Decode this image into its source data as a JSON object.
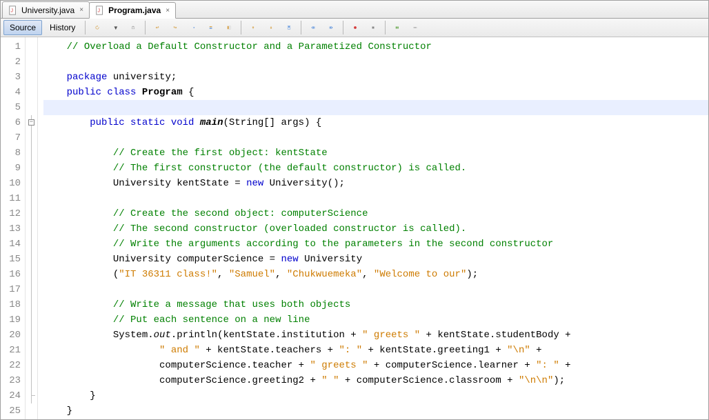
{
  "tabs": [
    {
      "title": "University.java",
      "active": false
    },
    {
      "title": "Program.java",
      "active": true
    }
  ],
  "toolbar": {
    "source": "Source",
    "history": "History"
  },
  "code": {
    "lines": [
      {
        "n": 1,
        "segs": [
          {
            "t": "    ",
            "c": ""
          },
          {
            "t": "// Overload a Default Constructor and a Parametized Constructor",
            "c": "cmt"
          }
        ]
      },
      {
        "n": 2,
        "segs": [
          {
            "t": " ",
            "c": ""
          }
        ]
      },
      {
        "n": 3,
        "segs": [
          {
            "t": "    ",
            "c": ""
          },
          {
            "t": "package ",
            "c": "kw"
          },
          {
            "t": "university;",
            "c": "id"
          }
        ]
      },
      {
        "n": 4,
        "segs": [
          {
            "t": "    ",
            "c": ""
          },
          {
            "t": "public class ",
            "c": "kw"
          },
          {
            "t": "Program",
            "c": "id bold"
          },
          {
            "t": " {",
            "c": "id"
          }
        ]
      },
      {
        "n": 5,
        "segs": [
          {
            "t": " ",
            "c": ""
          }
        ],
        "current": true
      },
      {
        "n": 6,
        "segs": [
          {
            "t": "        ",
            "c": ""
          },
          {
            "t": "public static void ",
            "c": "kw"
          },
          {
            "t": "main",
            "c": "id bold italic"
          },
          {
            "t": "(String[] args) {",
            "c": "id"
          }
        ],
        "foldbox": true
      },
      {
        "n": 7,
        "segs": [
          {
            "t": " ",
            "c": ""
          }
        ]
      },
      {
        "n": 8,
        "segs": [
          {
            "t": "            ",
            "c": ""
          },
          {
            "t": "// Create the first object: kentState",
            "c": "cmt"
          }
        ]
      },
      {
        "n": 9,
        "segs": [
          {
            "t": "            ",
            "c": ""
          },
          {
            "t": "// The first constructor (the default constructor) is called.",
            "c": "cmt"
          }
        ]
      },
      {
        "n": 10,
        "segs": [
          {
            "t": "            ",
            "c": ""
          },
          {
            "t": "University kentState = ",
            "c": "id"
          },
          {
            "t": "new ",
            "c": "kw"
          },
          {
            "t": "University();",
            "c": "id"
          }
        ]
      },
      {
        "n": 11,
        "segs": [
          {
            "t": " ",
            "c": ""
          }
        ]
      },
      {
        "n": 12,
        "segs": [
          {
            "t": "            ",
            "c": ""
          },
          {
            "t": "// Create the second object: computerScience",
            "c": "cmt"
          }
        ]
      },
      {
        "n": 13,
        "segs": [
          {
            "t": "            ",
            "c": ""
          },
          {
            "t": "// The second constructor (overloaded constructor is called).",
            "c": "cmt"
          }
        ]
      },
      {
        "n": 14,
        "segs": [
          {
            "t": "            ",
            "c": ""
          },
          {
            "t": "// Write the arguments according to the parameters in the second constructor",
            "c": "cmt"
          }
        ]
      },
      {
        "n": 15,
        "segs": [
          {
            "t": "            ",
            "c": ""
          },
          {
            "t": "University computerScience = ",
            "c": "id"
          },
          {
            "t": "new ",
            "c": "kw"
          },
          {
            "t": "University",
            "c": "id"
          }
        ]
      },
      {
        "n": 16,
        "segs": [
          {
            "t": "            (",
            "c": "id"
          },
          {
            "t": "\"IT 36311 class!\"",
            "c": "str"
          },
          {
            "t": ", ",
            "c": "id"
          },
          {
            "t": "\"Samuel\"",
            "c": "str"
          },
          {
            "t": ", ",
            "c": "id"
          },
          {
            "t": "\"Chukwuemeka\"",
            "c": "str"
          },
          {
            "t": ", ",
            "c": "id"
          },
          {
            "t": "\"Welcome to our\"",
            "c": "str"
          },
          {
            "t": ");",
            "c": "id"
          }
        ]
      },
      {
        "n": 17,
        "segs": [
          {
            "t": " ",
            "c": ""
          }
        ]
      },
      {
        "n": 18,
        "segs": [
          {
            "t": "            ",
            "c": ""
          },
          {
            "t": "// Write a message that uses both objects",
            "c": "cmt"
          }
        ]
      },
      {
        "n": 19,
        "segs": [
          {
            "t": "            ",
            "c": ""
          },
          {
            "t": "// Put each sentence on a new line",
            "c": "cmt"
          }
        ]
      },
      {
        "n": 20,
        "segs": [
          {
            "t": "            ",
            "c": ""
          },
          {
            "t": "System.",
            "c": "id"
          },
          {
            "t": "out",
            "c": "id italic"
          },
          {
            "t": ".println(kentState.institution + ",
            "c": "id"
          },
          {
            "t": "\" greets \"",
            "c": "str"
          },
          {
            "t": " + kentState.studentBody + ",
            "c": "id"
          }
        ]
      },
      {
        "n": 21,
        "segs": [
          {
            "t": "                    ",
            "c": ""
          },
          {
            "t": "\" and \"",
            "c": "str"
          },
          {
            "t": " + kentState.teachers + ",
            "c": "id"
          },
          {
            "t": "\": \"",
            "c": "str"
          },
          {
            "t": " + kentState.greeting1 + ",
            "c": "id"
          },
          {
            "t": "\"\\n\"",
            "c": "str"
          },
          {
            "t": " + ",
            "c": "id"
          }
        ]
      },
      {
        "n": 22,
        "segs": [
          {
            "t": "                    ",
            "c": ""
          },
          {
            "t": "computerScience.teacher + ",
            "c": "id"
          },
          {
            "t": "\" greets \"",
            "c": "str"
          },
          {
            "t": " + computerScience.learner + ",
            "c": "id"
          },
          {
            "t": "\": \"",
            "c": "str"
          },
          {
            "t": " + ",
            "c": "id"
          }
        ]
      },
      {
        "n": 23,
        "segs": [
          {
            "t": "                    ",
            "c": ""
          },
          {
            "t": "computerScience.greeting2 + ",
            "c": "id"
          },
          {
            "t": "\" \"",
            "c": "str"
          },
          {
            "t": " + computerScience.classroom + ",
            "c": "id"
          },
          {
            "t": "\"\\n\\n\"",
            "c": "str"
          },
          {
            "t": ");",
            "c": "id"
          }
        ]
      },
      {
        "n": 24,
        "segs": [
          {
            "t": "        }",
            "c": "id"
          }
        ],
        "foldend": true
      },
      {
        "n": 25,
        "segs": [
          {
            "t": "    }",
            "c": "id"
          }
        ]
      }
    ]
  }
}
